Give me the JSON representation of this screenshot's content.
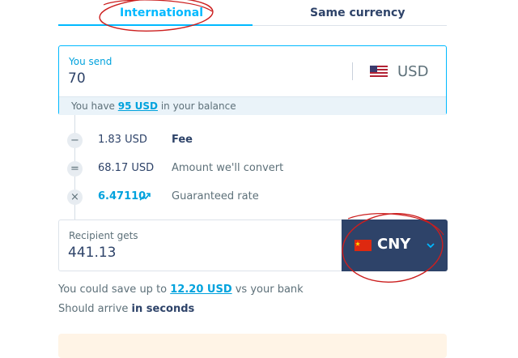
{
  "tabs": {
    "international": "International",
    "same_currency": "Same currency"
  },
  "send": {
    "label": "You send",
    "amount": "70",
    "currency": "USD",
    "balance_prefix": "You have ",
    "balance_amount": "95 USD",
    "balance_suffix": " in your balance"
  },
  "breakdown": {
    "fee": {
      "symbol": "−",
      "value": "1.83 USD",
      "label": "Fee"
    },
    "convert": {
      "symbol": "=",
      "value": "68.17 USD",
      "label": "Amount we'll convert"
    },
    "rate": {
      "symbol": "×",
      "value": "6.47110",
      "label": "Guaranteed rate"
    }
  },
  "receive": {
    "label": "Recipient gets",
    "amount": "441.13",
    "currency": "CNY"
  },
  "savings": {
    "prefix": "You could save up to ",
    "amount": "12.20 USD",
    "suffix": " vs your bank"
  },
  "arrival": {
    "prefix": "Should arrive ",
    "strong": "in seconds"
  },
  "icons": {
    "us_flag": "us-flag-icon",
    "cn_flag": "china-flag-icon",
    "trend": "trend-up-icon",
    "chevron": "chevron-down-icon"
  },
  "colors": {
    "accent": "#00b9ff",
    "navy": "#2e4369",
    "annotation": "#cc1f1f"
  }
}
